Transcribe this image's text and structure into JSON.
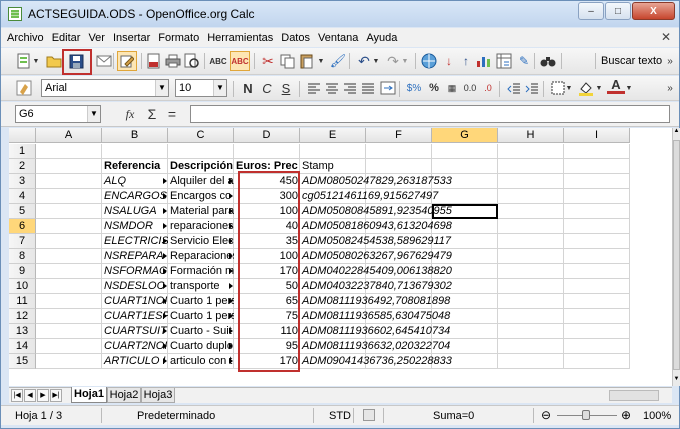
{
  "window": {
    "title": "ACTSEGUIDA.ODS - OpenOffice.org Calc",
    "min": "–",
    "max": "□",
    "close": "X"
  },
  "menu": [
    "Archivo",
    "Editar",
    "Ver",
    "Insertar",
    "Formato",
    "Herramientas",
    "Datos",
    "Ventana",
    "Ayuda"
  ],
  "toolbar": {
    "search_label": "Buscar texto"
  },
  "format": {
    "font": "Arial",
    "size": "10",
    "bold": "N",
    "italic": "C",
    "underline": "S",
    "percent": "%",
    "currency": "$%",
    "decimal": "0.0",
    "font_color": "A"
  },
  "formula": {
    "name_box": "G6",
    "fx": "fx",
    "sum": "Σ",
    "equals": "="
  },
  "columns": [
    "A",
    "B",
    "C",
    "D",
    "E",
    "F",
    "G",
    "H",
    "I"
  ],
  "rows": [
    "1",
    "2",
    "3",
    "4",
    "5",
    "6",
    "7",
    "8",
    "9",
    "10",
    "11",
    "12",
    "13",
    "14",
    "15"
  ],
  "headers": {
    "b": "Referencia",
    "c": "Descripción",
    "d": "Euros: Prec",
    "e": "Stamp"
  },
  "records": [
    {
      "ref": "ALQ",
      "desc": "Alquiler del a",
      "euros": "450",
      "stamp": "ADM08050247829,263187533"
    },
    {
      "ref": "ENCARGOS",
      "desc": "Encargos co",
      "euros": "300",
      "stamp": "cg05121461169,915627497"
    },
    {
      "ref": "NSALUGA",
      "desc": "Material para",
      "euros": "100",
      "stamp": "ADM05080845891,923540955"
    },
    {
      "ref": "NSMDOR",
      "desc": "reparaciones",
      "euros": "40",
      "stamp": "ADM05081860943,613204698"
    },
    {
      "ref": "ELECTRICIS",
      "desc": "Servicio Elec",
      "euros": "35",
      "stamp": "ADM05082454538,589629117"
    },
    {
      "ref": "NSREPARA",
      "desc": "Reparaciones",
      "euros": "100",
      "stamp": "ADM05080263267,967629479"
    },
    {
      "ref": "NSFORMAC",
      "desc": "Formación m",
      "euros": "170",
      "stamp": "ADM04022845409,006138820"
    },
    {
      "ref": "NSDESLOC",
      "desc": "transporte",
      "euros": "50",
      "stamp": "ADM04032237840,713679302"
    },
    {
      "ref": "CUART1NOI",
      "desc": "Cuarto 1 pers",
      "euros": "65",
      "stamp": "ADM08111936492,708081898"
    },
    {
      "ref": "CUART1ESP",
      "desc": "Cuarto 1 pers",
      "euros": "75",
      "stamp": "ADM08111936585,630475048"
    },
    {
      "ref": "CUARTSUIT",
      "desc": "Cuarto - Suit",
      "euros": "110",
      "stamp": "ADM08111936602,645410734"
    },
    {
      "ref": "CUART2NOI",
      "desc": "Cuarto duplo",
      "euros": "95",
      "stamp": "ADM08111936632,020322704"
    },
    {
      "ref": "ARTICULO I",
      "desc": "articulo con t",
      "euros": "170",
      "stamp": "ADM09041436736,250228833"
    }
  ],
  "sheets": [
    "Hoja1",
    "Hoja2",
    "Hoja3"
  ],
  "status": {
    "page": "Hoja 1 / 3",
    "style": "Predeterminado",
    "mode": "STD",
    "sum": "Suma=0",
    "zoom": "100%"
  },
  "colors": {
    "highlight": "#c0302e",
    "selected_col": "#ffd77a"
  }
}
